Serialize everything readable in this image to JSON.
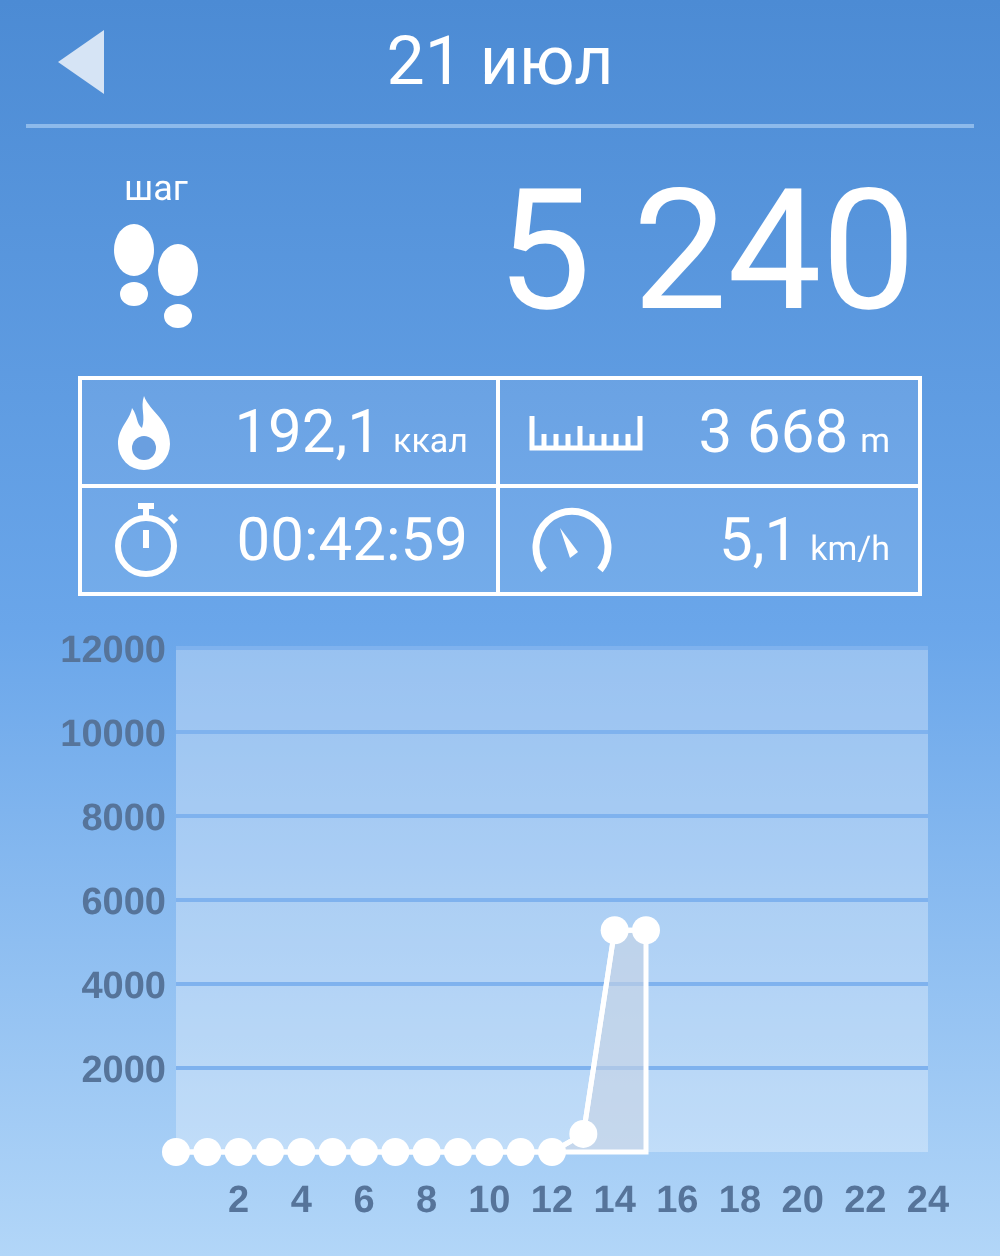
{
  "header": {
    "title": "21 июл"
  },
  "steps": {
    "label": "шаг",
    "value": "5 240"
  },
  "stats": [
    {
      "kind": "calories",
      "value": "192,1",
      "unit": "ккал"
    },
    {
      "kind": "distance",
      "value": "3 668",
      "unit": "m"
    },
    {
      "kind": "duration",
      "value": "00:42:59"
    },
    {
      "kind": "speed",
      "value": "5,1",
      "unit": "km/h"
    }
  ],
  "chart": {
    "chart_data": {
      "type": "area",
      "x": [
        0,
        1,
        2,
        3,
        4,
        5,
        6,
        7,
        8,
        9,
        10,
        11,
        12,
        13,
        14,
        15
      ],
      "grid": true,
      "series": [
        {
          "color": "#ffffff",
          "values": [
            0,
            0,
            0,
            0,
            0,
            0,
            0,
            0,
            0,
            0,
            0,
            0,
            0,
            430,
            5280,
            5280
          ]
        }
      ],
      "xlim": [
        0,
        24
      ],
      "ylim": [
        0,
        12000
      ],
      "xticks": [
        2,
        4,
        6,
        8,
        10,
        12,
        14,
        16,
        18,
        20,
        22,
        24
      ],
      "yticks": [
        2000,
        4000,
        6000,
        8000,
        10000,
        12000
      ]
    }
  }
}
